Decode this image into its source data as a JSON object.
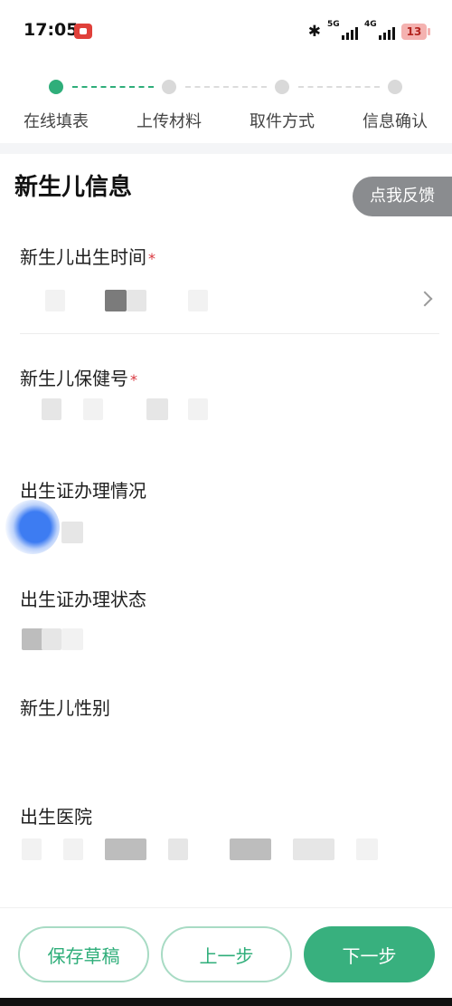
{
  "status_bar": {
    "time": "17:05",
    "network_1": "5G",
    "network_2": "4G",
    "battery": "13",
    "icons": [
      "screen-record-icon",
      "bluetooth-icon",
      "signal-5g-icon",
      "signal-4g-icon",
      "battery-icon"
    ]
  },
  "steps": [
    {
      "label": "在线填表",
      "state": "active"
    },
    {
      "label": "上传材料",
      "state": "pending"
    },
    {
      "label": "取件方式",
      "state": "pending"
    },
    {
      "label": "信息确认",
      "state": "pending"
    }
  ],
  "section": {
    "title": "新生儿信息"
  },
  "feedback": {
    "label": "点我反馈"
  },
  "fields": {
    "birth_time": {
      "label": "新生儿出生时间",
      "required_mark": "*"
    },
    "health_no": {
      "label": "新生儿保健号",
      "required_mark": "*"
    },
    "cert_situation": {
      "label": "出生证办理情况"
    },
    "cert_status": {
      "label": "出生证办理状态"
    },
    "gender": {
      "label": "新生儿性别"
    },
    "hospital": {
      "label": "出生医院"
    }
  },
  "actions": {
    "save_draft": "保存草稿",
    "prev": "上一步",
    "next": "下一步"
  },
  "colors": {
    "accent": "#2fae7a",
    "required": "#d9363e",
    "feedback_bg": "#8a8c8f"
  }
}
